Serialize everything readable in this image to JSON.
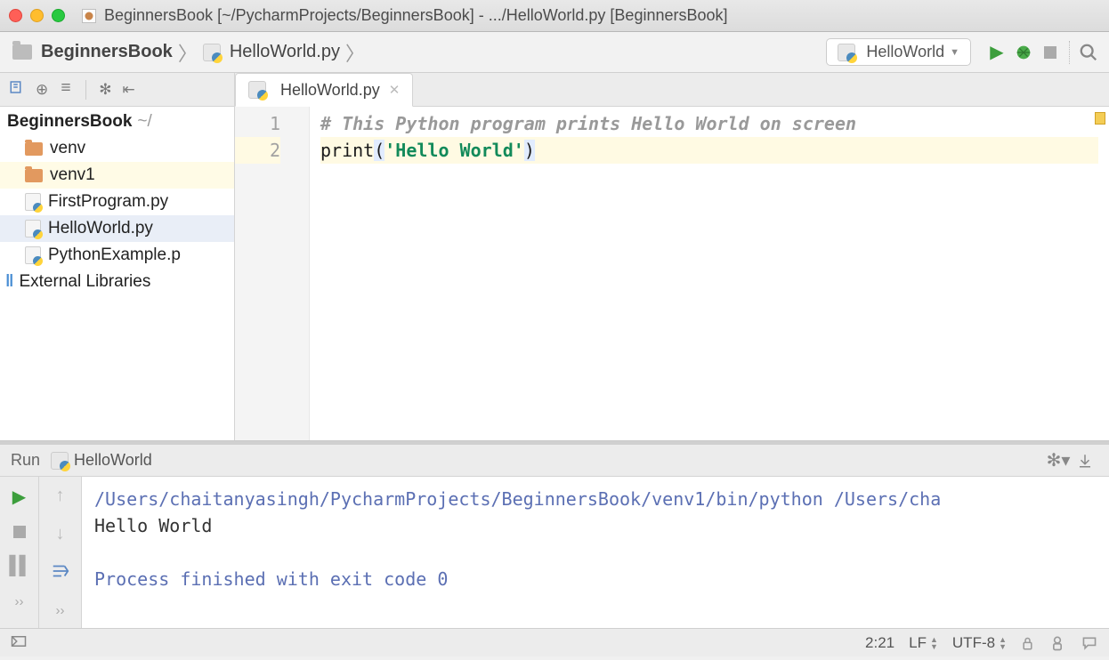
{
  "title": "BeginnersBook [~/PycharmProjects/BeginnersBook] - .../HelloWorld.py [BeginnersBook]",
  "breadcrumb": {
    "project": "BeginnersBook",
    "file": "HelloWorld.py"
  },
  "run_config": {
    "name": "HelloWorld"
  },
  "project_tree": {
    "root": "BeginnersBook",
    "root_path": "~/",
    "items": [
      {
        "name": "venv",
        "type": "folder"
      },
      {
        "name": "venv1",
        "type": "folder"
      },
      {
        "name": "FirstProgram.py",
        "type": "py"
      },
      {
        "name": "HelloWorld.py",
        "type": "py"
      },
      {
        "name": "PythonExample.p",
        "type": "py"
      }
    ],
    "external": "External Libraries"
  },
  "tab": {
    "label": "HelloWorld.py"
  },
  "code": {
    "lines": [
      {
        "n": "1",
        "comment": "# This Python program prints Hello World on screen"
      },
      {
        "n": "2",
        "call": "print",
        "paren_l": "(",
        "str": "'Hello World'",
        "paren_r": ")"
      }
    ]
  },
  "run_panel": {
    "label": "Run",
    "config": "HelloWorld",
    "cmd": "/Users/chaitanyasingh/PycharmProjects/BeginnersBook/venv1/bin/python /Users/cha",
    "output": "Hello World",
    "exit_msg": "Process finished with exit code 0"
  },
  "status": {
    "pos": "2:21",
    "linesep": "LF",
    "encoding": "UTF-8"
  }
}
